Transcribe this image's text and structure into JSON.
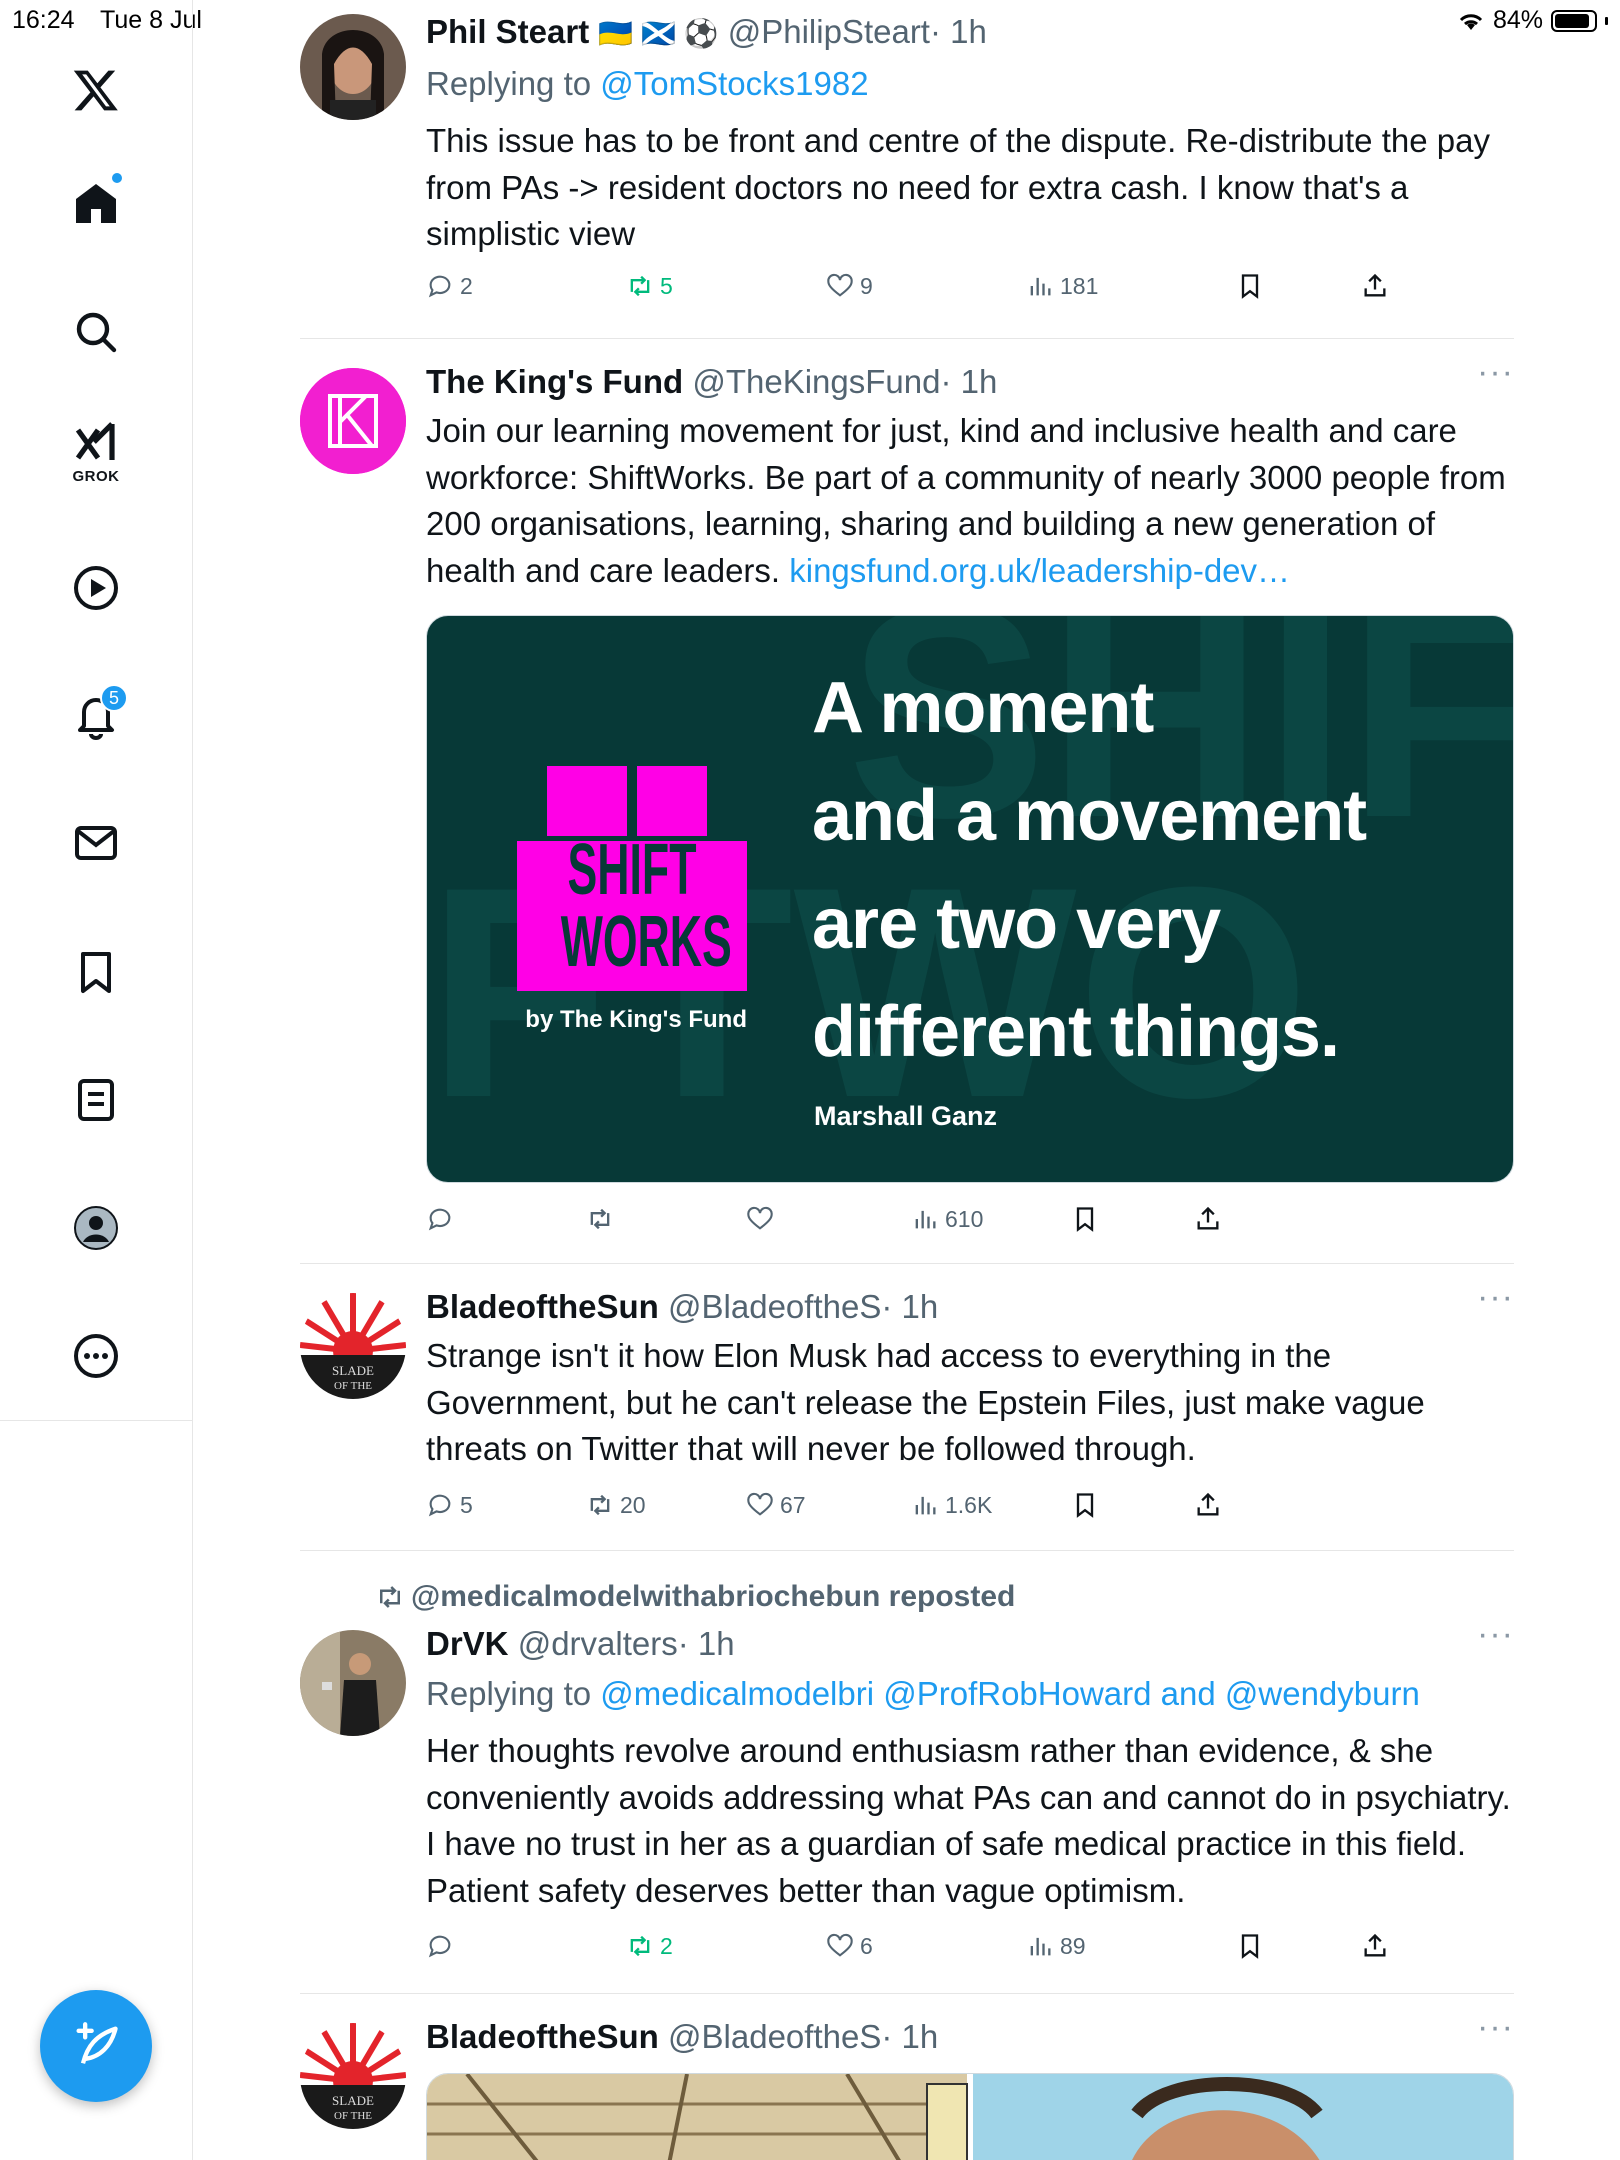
{
  "status": {
    "time": "16:24",
    "date": "Tue 8 Jul",
    "battery": "84%"
  },
  "sidebar": {
    "grok_label": "GROK",
    "notifications_count": "5"
  },
  "tweets": [
    {
      "name": "Phil Steart",
      "emojis": "🇺🇦 🏴󠁧󠁢󠁳󠁣󠁴󠁿 ⚽",
      "handle": "@PhilipSteart",
      "time": "· 1h",
      "replying_prefix": "Replying to",
      "replying_to": "@TomStocks1982",
      "body": "This issue has to be front and centre of the dispute. Re-distribute the pay from PAs -> resident doctors no need for extra cash. I know that's a simplistic view",
      "replies": "2",
      "reposts": "5",
      "likes": "9",
      "views": "181"
    },
    {
      "name": "The King's Fund",
      "handle": "@TheKingsFund",
      "time": "· 1h",
      "body": "Join our learning movement for just, kind and inclusive health and care workforce: ShiftWorks. Be part of a community of nearly 3000 people from 200 organisations, learning, sharing and building a new generation of health and care leaders.",
      "link": "kingsfund.org.uk/leadership-dev…",
      "media": {
        "logo_line1": "SHIFT",
        "logo_line2": "WORKS",
        "byline": "by The King's Fund",
        "quote_lines": [
          "A moment",
          "and a movement",
          "are two very",
          "different things."
        ],
        "author": "Marshall Ganz"
      },
      "views": "610"
    },
    {
      "name": "BladeoftheSun",
      "handle": "@BladeoftheS",
      "time": "· 1h",
      "body": "Strange isn't it how Elon Musk had access to everything in the Government, but he can't release the Epstein Files, just make vague threats on Twitter that will never be followed through.",
      "replies": "5",
      "reposts": "20",
      "likes": "67",
      "views": "1.6K"
    },
    {
      "repost_by": "@medicalmodelwithabriochebun reposted",
      "name": "DrVK",
      "handle": "@drvalters",
      "time": "· 1h",
      "replying_prefix": "Replying to",
      "replying_to": "@medicalmodelbri @ProfRobHoward and @wendyburn",
      "body": "Her thoughts revolve around enthusiasm rather than evidence, & she conveniently avoids addressing what PAs can and cannot do in psychiatry. I have no trust in her as a guardian of safe medical practice in this field. Patient safety deserves better than vague optimism.",
      "reposts": "2",
      "likes": "6",
      "views": "89"
    },
    {
      "name": "BladeoftheSun",
      "handle": "@BladeoftheS",
      "time": "· 1h"
    }
  ],
  "colors": {
    "accent": "#1d9bf0",
    "repost_green": "#00ba7c",
    "card_bg": "#073937",
    "shiftworks_magenta": "#ff00e6"
  }
}
